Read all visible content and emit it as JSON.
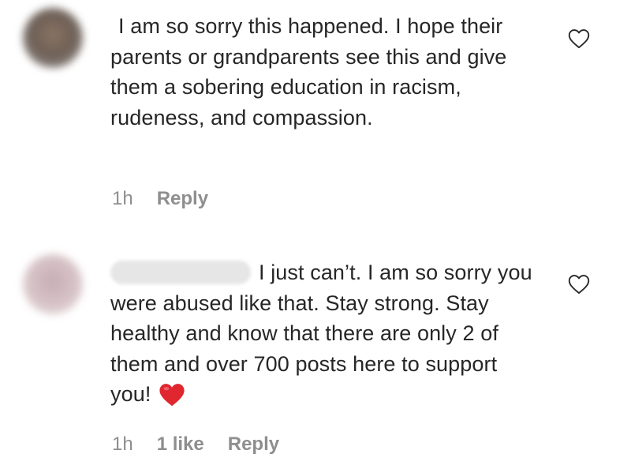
{
  "comments": [
    {
      "text": "I am so sorry this happened. I hope their parents or grandparents see this and give them a sobering education in racism, rudeness, and compassion.",
      "time": "1h",
      "likes": "",
      "reply_label": "Reply",
      "like_icon": "heart-outline-icon"
    },
    {
      "text": "I just can’t. I am so sorry you were abused like that. Stay strong. Stay healthy and know that there are only 2 of them and over 700 posts here to support you!",
      "time": "1h",
      "likes": "1 like",
      "reply_label": "Reply",
      "like_icon": "heart-outline-icon",
      "emoji": "red-heart-emoji"
    }
  ],
  "colors": {
    "text": "#262626",
    "meta": "#8e8e8e",
    "emoji_heart": "#e0262f"
  }
}
